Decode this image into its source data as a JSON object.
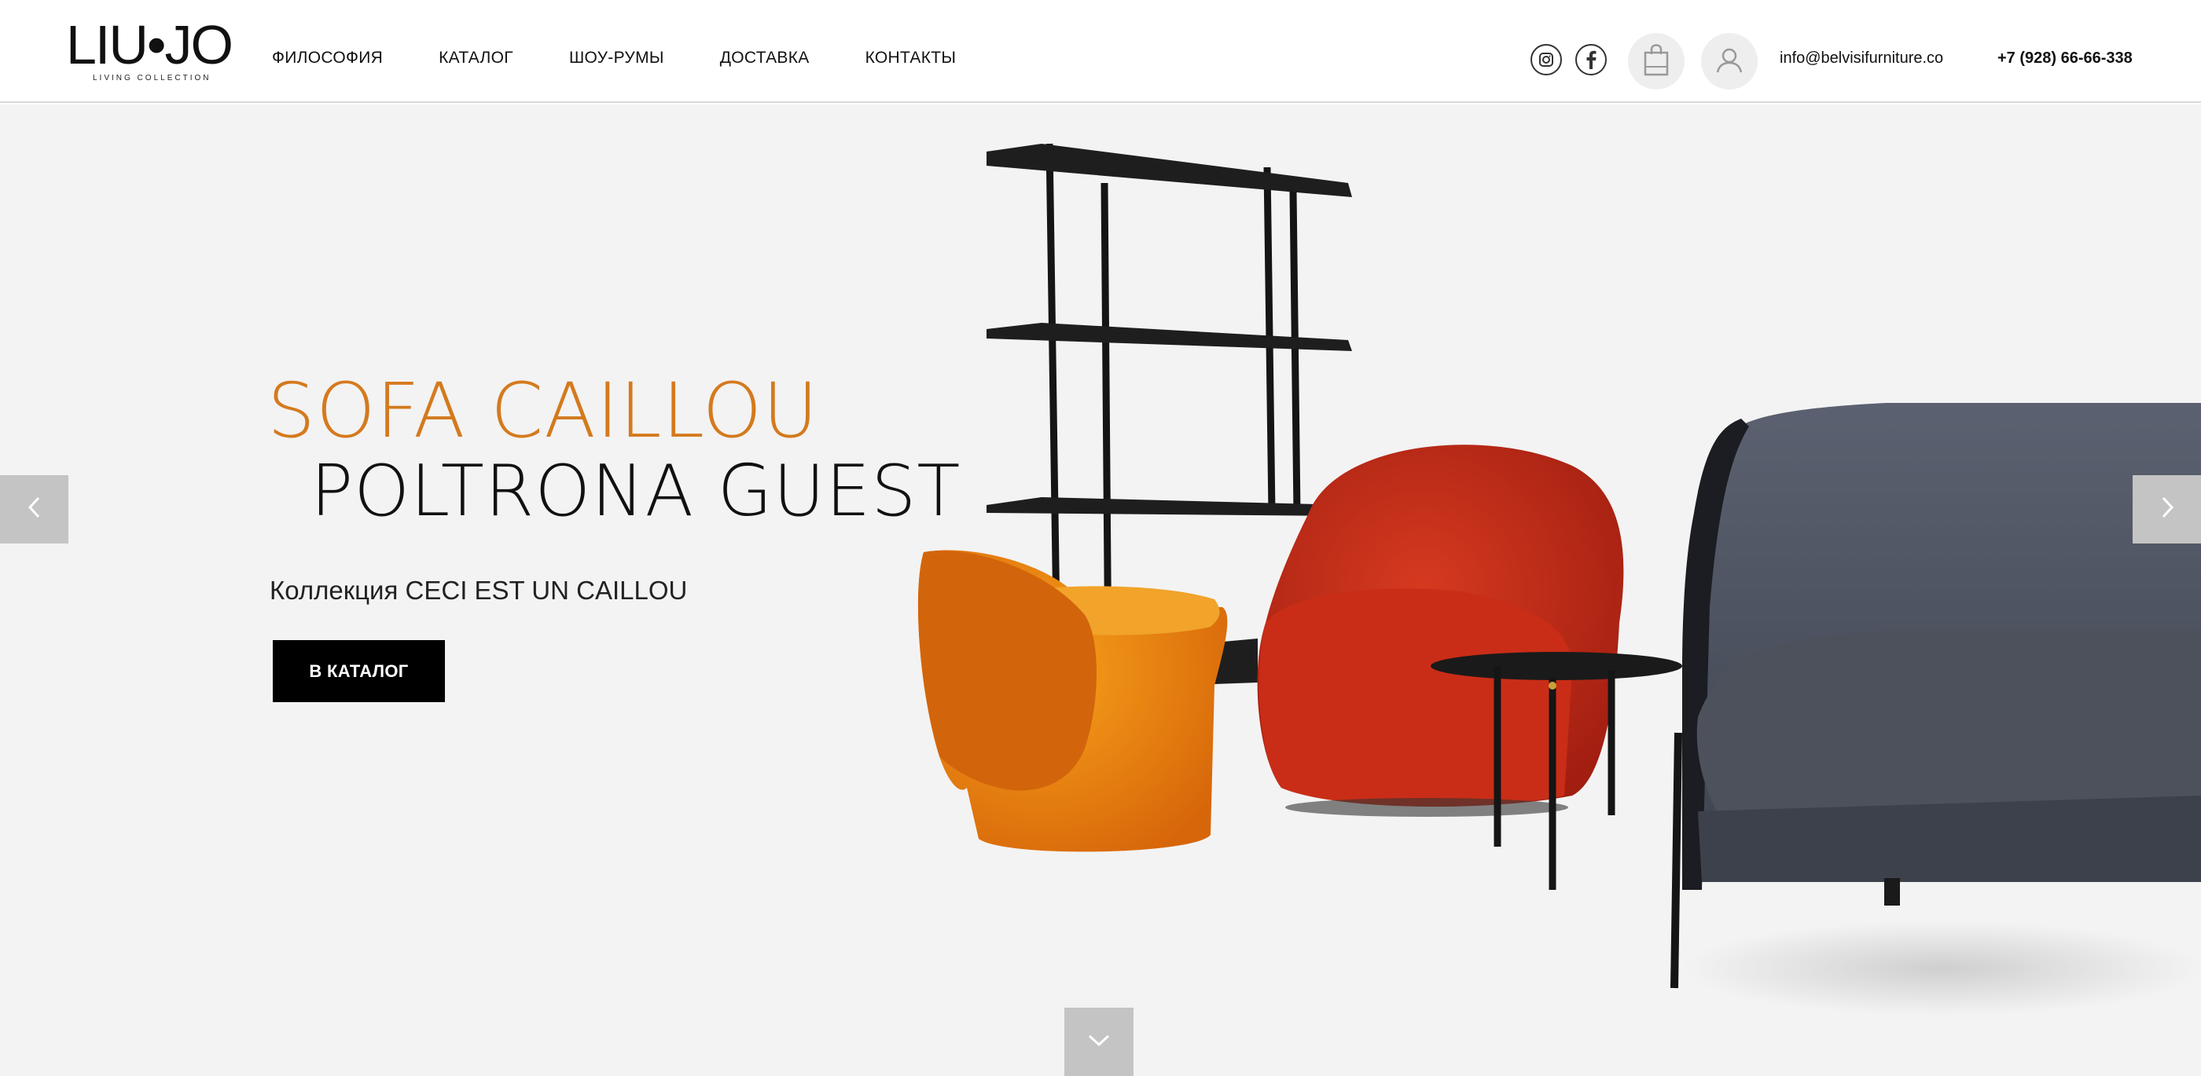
{
  "brand": {
    "logo_text": "LIU•JO",
    "logo_sub": "LIVING COLLECTION"
  },
  "nav": {
    "items": [
      {
        "label": "ФИЛОСОФИЯ"
      },
      {
        "label": "КАТАЛОГ"
      },
      {
        "label": "ШОУ-РУМЫ"
      },
      {
        "label": "ДОСТАВКА"
      },
      {
        "label": "КОНТАКТЫ"
      }
    ]
  },
  "header": {
    "social_icons": [
      "instagram-icon",
      "facebook-icon"
    ],
    "cart_icon": "shopping-bag-icon",
    "user_icon": "user-icon",
    "email": "info@belvisifurniture.co",
    "phone": "+7 (928) 66-66-338"
  },
  "hero": {
    "title_line1": "SOFA CAILLOU",
    "title_line2": "POLTRONA GUEST",
    "subtitle": "Коллекция CECI EST UN CAILLOU",
    "cta_label": "В КАТАЛОГ",
    "prev_icon": "chevron-left-icon",
    "next_icon": "chevron-right-icon",
    "scroll_icon": "chevron-down-icon"
  },
  "colors": {
    "accent": "#d47a1e",
    "hero_bg": "#f3f3f3",
    "button_bg": "#000000",
    "arrow_bg": "#c4c4c4"
  }
}
